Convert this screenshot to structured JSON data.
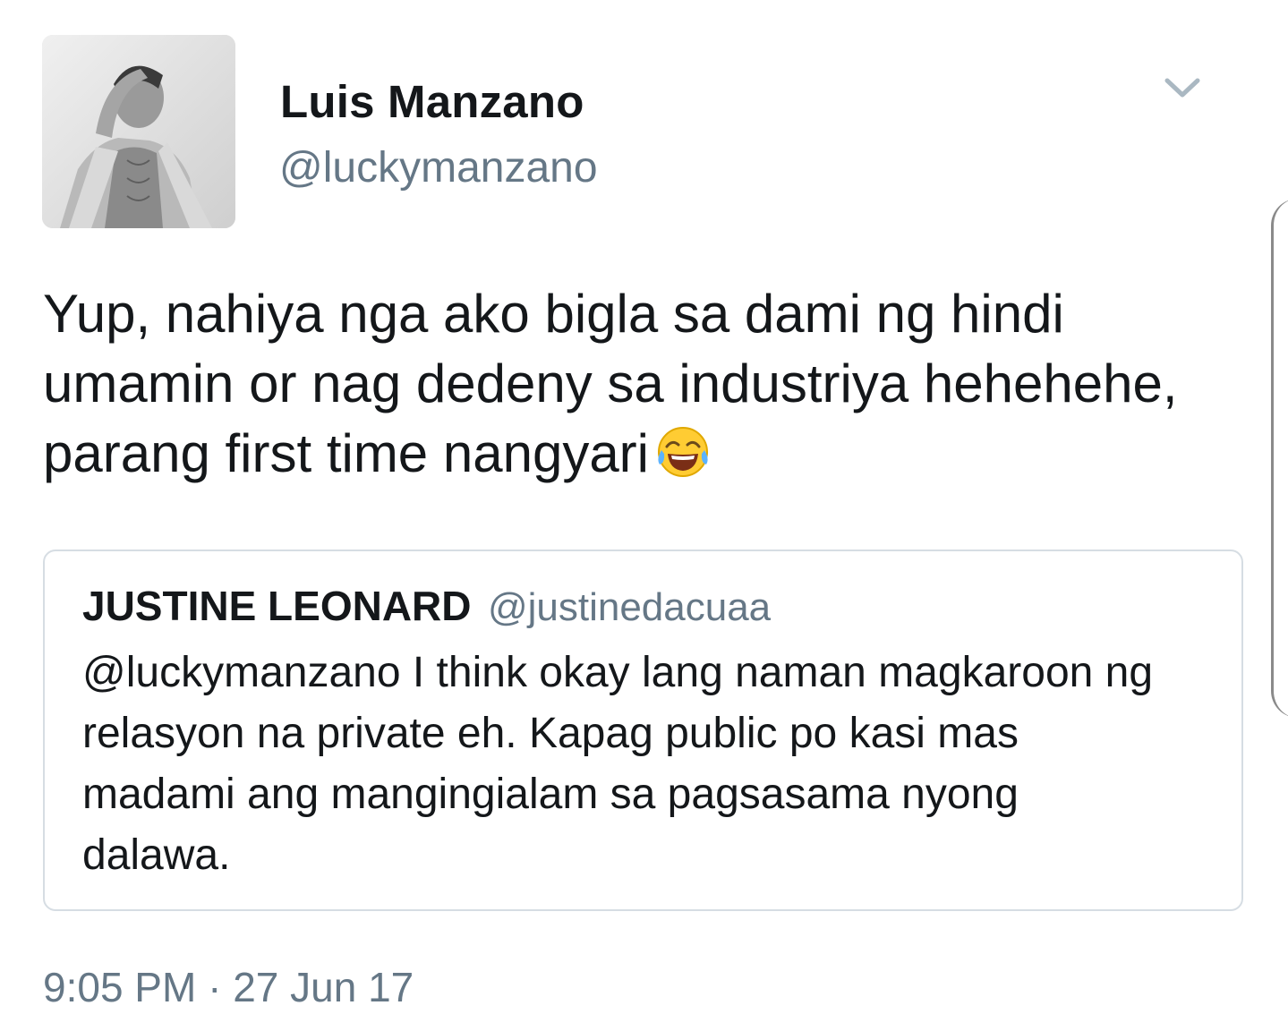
{
  "tweet": {
    "author_name": "Luis Manzano",
    "author_handle": "@luckymanzano",
    "menu_icon": "chevron-down-icon",
    "text_lines": [
      "Yup, nahiya nga ako bigla sa dami ng hindi",
      "umamin or nag dedeny sa industriya hehehehe,",
      "parang first time nangyari"
    ],
    "emoji": "face-with-tears-of-joy-icon",
    "timestamp": "9:05 PM · 27 Jun 17"
  },
  "quoted_tweet": {
    "author_name": "JUSTINE LEONARD",
    "author_handle": "@justinedacuaa",
    "text_lines": [
      "@luckymanzano I think okay lang naman magkaroon ng",
      "relasyon na private eh. Kapag public po kasi mas",
      "madami ang mangingialam sa pagsasama nyong",
      "dalawa."
    ]
  },
  "colors": {
    "primary_text": "#14171a",
    "secondary_text": "#657786",
    "border": "#d6dde3"
  }
}
